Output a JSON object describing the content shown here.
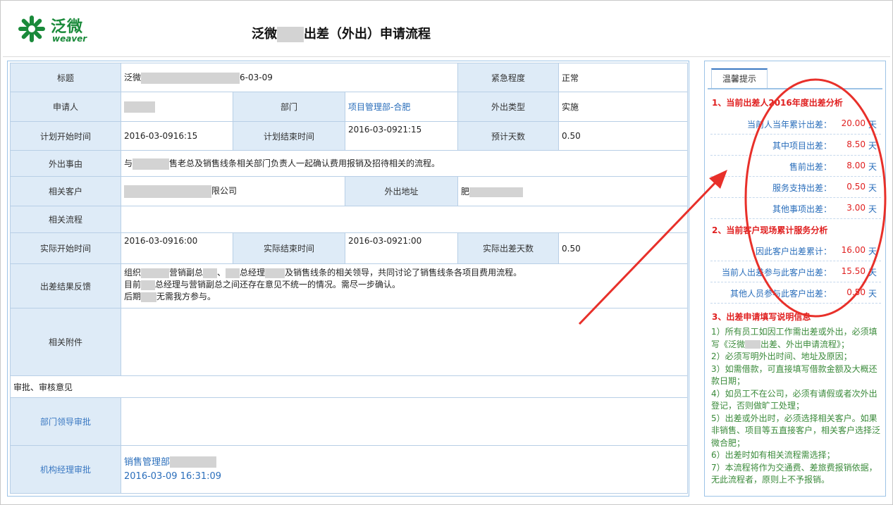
{
  "brand": {
    "name": "泛微",
    "sub": "weaver"
  },
  "page_title": {
    "prefix": "泛微",
    "suffix": "出差（外出）申请流程"
  },
  "form": {
    "title_label": "标题",
    "title_value_prefix": "泛微",
    "title_value_suffix": "6-03-09",
    "urgency_label": "紧急程度",
    "urgency_value": "正常",
    "applicant_label": "申请人",
    "dept_label": "部门",
    "dept_value": "项目管理部-合肥",
    "out_type_label": "外出类型",
    "out_type_value": "实施",
    "plan_start_label": "计划开始时间",
    "plan_start_value": "2016-03-0916:15",
    "plan_end_label": "计划结束时间",
    "plan_end_value": "2016-03-0921:15",
    "est_days_label": "预计天数",
    "est_days_value": "0.50",
    "reason_label": "外出事由",
    "reason_prefix": "与",
    "reason_suffix": "售老总及销售线条相关部门负责人一起确认费用报销及招待相关的流程。",
    "customer_label": "相关客户",
    "customer_suffix": "限公司",
    "address_label": "外出地址",
    "address_prefix": "肥",
    "related_flow_label": "相关流程",
    "actual_start_label": "实际开始时间",
    "actual_start_value": "2016-03-0916:00",
    "actual_end_label": "实际结束时间",
    "actual_end_value": "2016-03-0921:00",
    "actual_days_label": "实际出差天数",
    "actual_days_value": "0.50",
    "feedback_label": "出差结果反馈",
    "feedback_line1_a": "组织",
    "feedback_line1_b": "营销副总",
    "feedback_line1_c": "、",
    "feedback_line1_d": "总经理",
    "feedback_line1_e": "及销售线条的相关领导，共同讨论了销售线条各项目费用流程。",
    "feedback_line2_a": "目前",
    "feedback_line2_b": "总经理与营销副总之间还存在意见不统一的情况。需尽一步确认。",
    "feedback_line3_a": "后期",
    "feedback_line3_b": "无需我方参与。",
    "attachment_label": "相关附件",
    "approval_section": "审批、审核意见",
    "dept_leader_label": "部门领导审批",
    "org_manager_label": "机构经理审批",
    "org_manager_value": "销售管理部",
    "org_manager_time": "2016-03-09 16:31:09"
  },
  "tips": {
    "tab_label": "温馨提示",
    "sec1_title": "1、当前出差人2016年度出差分析",
    "sec1_rows": [
      {
        "label": "当前人当年累计出差：",
        "value": "20.00",
        "unit": "天"
      },
      {
        "label": "其中项目出差：",
        "value": "8.50",
        "unit": "天"
      },
      {
        "label": "售前出差：",
        "value": "8.00",
        "unit": "天"
      },
      {
        "label": "服务支持出差：",
        "value": "0.50",
        "unit": "天"
      },
      {
        "label": "其他事项出差：",
        "value": "3.00",
        "unit": "天"
      }
    ],
    "sec2_title": "2、当前客户现场累计服务分析",
    "sec2_rows": [
      {
        "label": "因此客户出差累计：",
        "value": "16.00",
        "unit": "天"
      },
      {
        "label": "当前人出差参与此客户出差：",
        "value": "15.50",
        "unit": "天"
      },
      {
        "label": "其他人员参与此客户出差：",
        "value": "0.50",
        "unit": "天"
      }
    ],
    "sec3_title": "3、出差申请填写说明信息",
    "note1_prefix": "1）所有员工如因工作需出差或外出，必须填写《泛微",
    "note1_suffix": "出差、外出申请流程》；",
    "notes": [
      "2）必须写明外出时间、地址及原因；",
      "3）如需借款，可直接填写借款金额及大概还款日期；",
      "4）如员工不在公司，必须有请假或者次外出登记，否则做旷工处理；",
      "5）出差或外出时，必须选择相关客户。如果非销售、项目等五直接客户，相关客户选择泛微合肥；",
      "6）出差时如有相关流程需选择；",
      "7）本流程将作为交通费、差旅费报销依据，无此流程者，原则上不予报销。"
    ]
  },
  "colors": {
    "brand_green": "#1a8a3a",
    "label_bg": "#deebf7",
    "accent_red": "#e02020",
    "link_blue": "#2a6ebb"
  }
}
